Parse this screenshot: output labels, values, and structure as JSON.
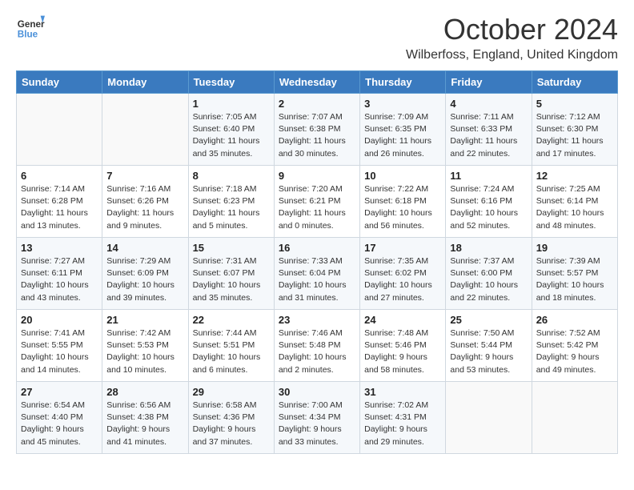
{
  "header": {
    "logo_line1": "General",
    "logo_line2": "Blue",
    "month": "October 2024",
    "location": "Wilberfoss, England, United Kingdom"
  },
  "days_of_week": [
    "Sunday",
    "Monday",
    "Tuesday",
    "Wednesday",
    "Thursday",
    "Friday",
    "Saturday"
  ],
  "weeks": [
    [
      {
        "day": "",
        "info": ""
      },
      {
        "day": "",
        "info": ""
      },
      {
        "day": "1",
        "info": "Sunrise: 7:05 AM\nSunset: 6:40 PM\nDaylight: 11 hours and 35 minutes."
      },
      {
        "day": "2",
        "info": "Sunrise: 7:07 AM\nSunset: 6:38 PM\nDaylight: 11 hours and 30 minutes."
      },
      {
        "day": "3",
        "info": "Sunrise: 7:09 AM\nSunset: 6:35 PM\nDaylight: 11 hours and 26 minutes."
      },
      {
        "day": "4",
        "info": "Sunrise: 7:11 AM\nSunset: 6:33 PM\nDaylight: 11 hours and 22 minutes."
      },
      {
        "day": "5",
        "info": "Sunrise: 7:12 AM\nSunset: 6:30 PM\nDaylight: 11 hours and 17 minutes."
      }
    ],
    [
      {
        "day": "6",
        "info": "Sunrise: 7:14 AM\nSunset: 6:28 PM\nDaylight: 11 hours and 13 minutes."
      },
      {
        "day": "7",
        "info": "Sunrise: 7:16 AM\nSunset: 6:26 PM\nDaylight: 11 hours and 9 minutes."
      },
      {
        "day": "8",
        "info": "Sunrise: 7:18 AM\nSunset: 6:23 PM\nDaylight: 11 hours and 5 minutes."
      },
      {
        "day": "9",
        "info": "Sunrise: 7:20 AM\nSunset: 6:21 PM\nDaylight: 11 hours and 0 minutes."
      },
      {
        "day": "10",
        "info": "Sunrise: 7:22 AM\nSunset: 6:18 PM\nDaylight: 10 hours and 56 minutes."
      },
      {
        "day": "11",
        "info": "Sunrise: 7:24 AM\nSunset: 6:16 PM\nDaylight: 10 hours and 52 minutes."
      },
      {
        "day": "12",
        "info": "Sunrise: 7:25 AM\nSunset: 6:14 PM\nDaylight: 10 hours and 48 minutes."
      }
    ],
    [
      {
        "day": "13",
        "info": "Sunrise: 7:27 AM\nSunset: 6:11 PM\nDaylight: 10 hours and 43 minutes."
      },
      {
        "day": "14",
        "info": "Sunrise: 7:29 AM\nSunset: 6:09 PM\nDaylight: 10 hours and 39 minutes."
      },
      {
        "day": "15",
        "info": "Sunrise: 7:31 AM\nSunset: 6:07 PM\nDaylight: 10 hours and 35 minutes."
      },
      {
        "day": "16",
        "info": "Sunrise: 7:33 AM\nSunset: 6:04 PM\nDaylight: 10 hours and 31 minutes."
      },
      {
        "day": "17",
        "info": "Sunrise: 7:35 AM\nSunset: 6:02 PM\nDaylight: 10 hours and 27 minutes."
      },
      {
        "day": "18",
        "info": "Sunrise: 7:37 AM\nSunset: 6:00 PM\nDaylight: 10 hours and 22 minutes."
      },
      {
        "day": "19",
        "info": "Sunrise: 7:39 AM\nSunset: 5:57 PM\nDaylight: 10 hours and 18 minutes."
      }
    ],
    [
      {
        "day": "20",
        "info": "Sunrise: 7:41 AM\nSunset: 5:55 PM\nDaylight: 10 hours and 14 minutes."
      },
      {
        "day": "21",
        "info": "Sunrise: 7:42 AM\nSunset: 5:53 PM\nDaylight: 10 hours and 10 minutes."
      },
      {
        "day": "22",
        "info": "Sunrise: 7:44 AM\nSunset: 5:51 PM\nDaylight: 10 hours and 6 minutes."
      },
      {
        "day": "23",
        "info": "Sunrise: 7:46 AM\nSunset: 5:48 PM\nDaylight: 10 hours and 2 minutes."
      },
      {
        "day": "24",
        "info": "Sunrise: 7:48 AM\nSunset: 5:46 PM\nDaylight: 9 hours and 58 minutes."
      },
      {
        "day": "25",
        "info": "Sunrise: 7:50 AM\nSunset: 5:44 PM\nDaylight: 9 hours and 53 minutes."
      },
      {
        "day": "26",
        "info": "Sunrise: 7:52 AM\nSunset: 5:42 PM\nDaylight: 9 hours and 49 minutes."
      }
    ],
    [
      {
        "day": "27",
        "info": "Sunrise: 6:54 AM\nSunset: 4:40 PM\nDaylight: 9 hours and 45 minutes."
      },
      {
        "day": "28",
        "info": "Sunrise: 6:56 AM\nSunset: 4:38 PM\nDaylight: 9 hours and 41 minutes."
      },
      {
        "day": "29",
        "info": "Sunrise: 6:58 AM\nSunset: 4:36 PM\nDaylight: 9 hours and 37 minutes."
      },
      {
        "day": "30",
        "info": "Sunrise: 7:00 AM\nSunset: 4:34 PM\nDaylight: 9 hours and 33 minutes."
      },
      {
        "day": "31",
        "info": "Sunrise: 7:02 AM\nSunset: 4:31 PM\nDaylight: 9 hours and 29 minutes."
      },
      {
        "day": "",
        "info": ""
      },
      {
        "day": "",
        "info": ""
      }
    ]
  ]
}
